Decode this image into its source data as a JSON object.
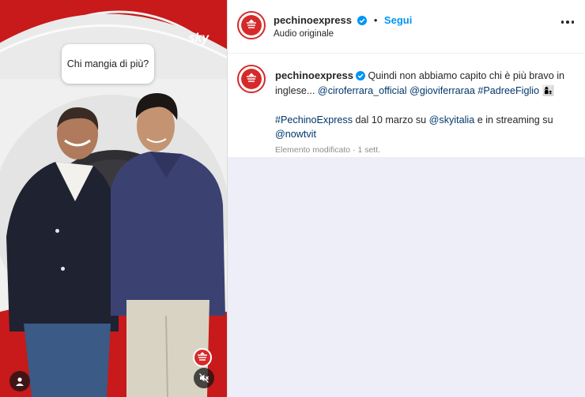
{
  "media": {
    "sticker_text": "Chi mangia di più?",
    "watermark": "sky"
  },
  "header": {
    "username": "pechinoexpress",
    "separator": "•",
    "follow_label": "Segui",
    "audio_label": "Audio originale"
  },
  "caption": {
    "username": "pechinoexpress",
    "text_1": "Quindi non abbiamo capito chi è più bravo in inglese...",
    "mention_1": "@ciroferrara_official",
    "mention_2": "@gioviferraraa",
    "hashtag_1": "#PadreeFiglio",
    "emoji_1": "👩‍👦",
    "hashtag_2": "#PechinoExpress",
    "text_2": "dal 10 marzo su",
    "mention_3": "@skyitalia",
    "text_3": "e in streaming su",
    "mention_4": "@nowtvit",
    "meta": "Elemento modificato · 1 sett."
  },
  "colors": {
    "accent": "#0095f6",
    "backdrop_red": "#c21a1a",
    "link": "#00376b"
  }
}
